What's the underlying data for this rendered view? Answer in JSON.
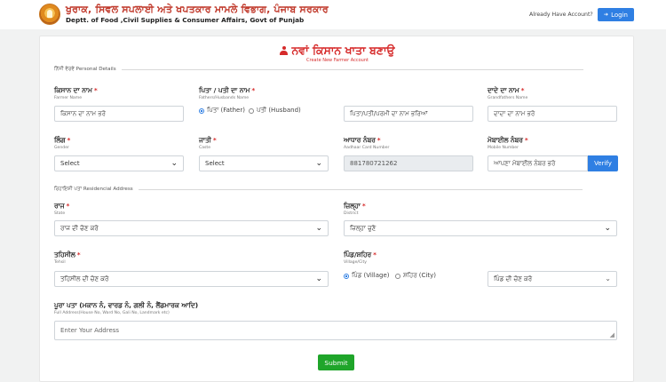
{
  "header": {
    "org_title": "ਖੁਰਾਕ, ਸਿਵਲ ਸਪਲਾਈ ਅਤੇ ਖਪਤਕਾਰ ਮਾਮਲੇ ਵਿਭਾਗ, ਪੰਜਾਬ ਸਰਕਾਰ",
    "org_subtitle": "Deptt. of Food ,Civil Supplies & Consumer Affairs, Govt of Punjab",
    "already_account": "Already Have Account?",
    "login_label": "Login",
    "logo_icon": "state-emblem-icon",
    "login_icon": "sign-in-icon"
  },
  "form": {
    "title": "ਨਵਾਂ ਕਿਸਾਨ ਖਾਤਾ ਬਣਾਉ",
    "subtitle": "Create New Farmer Account",
    "title_icon": "user-icon",
    "personal_section": "ਨਿੱਜੀ ਵੇਰਵੇ  Personal Details",
    "residential_section": "ਰਿਹਾਇਸ਼ੀ ਪਤਾ  Residencial Address",
    "farmer_name": {
      "label": "ਕਿਸਾਨ ਦਾ ਨਾਮ",
      "sublabel": "Farmer Name",
      "placeholder": "ਕਿਸਾਨ ਦਾ ਨਾਮ ਭਰੋ"
    },
    "father_husband": {
      "label": "ਪਿਤਾ / ਪਤੀ ਦਾ ਨਾਮ",
      "sublabel": "Fathers/Husbands Name",
      "option_father": "ਪਿਤਾ (Father)",
      "option_husband": "ਪਤੀ (Husband)",
      "placeholder": "ਪਿਤਾ/ਪਤੀ/ਪਰਮੀ ਦਾ ਨਾਮ ਭਰਿਆਂ"
    },
    "grandfather": {
      "label": "ਦਾਦੇ ਦਾ ਨਾਮ",
      "sublabel": "Grandfathers Name",
      "placeholder": "ਦਾਦਾ ਦਾ ਨਾਮ ਭਰੋ"
    },
    "gender": {
      "label": "ਲਿੰਗ",
      "sublabel": "Gender",
      "selected": "Select"
    },
    "caste": {
      "label": "ਜਾਤੀ",
      "sublabel": "Caste",
      "selected": "Select"
    },
    "aadhaar": {
      "label": "ਆਧਾਰ ਨੰਬਰ",
      "sublabel": "Aadhaar Card Number",
      "value": "881780721262"
    },
    "mobile": {
      "label": "ਮੋਬਾਈਲ ਨੰਬਰ",
      "sublabel": "Mobile Number",
      "placeholder": "ਆਪਣਾ ਮੋਬਾਈਲ ਨੰਬਰ ਭਰੋ",
      "verify_label": "Verify"
    },
    "state": {
      "label": "ਰਾਜ",
      "sublabel": "State",
      "selected": "ਰਾਜ ਦੀ ਚੋਣ ਕਰੋ"
    },
    "district": {
      "label": "ਜ਼ਿਲ੍ਹਾ",
      "sublabel": "District",
      "selected": "ਜ਼ਿਲ੍ਹਾ ਚੁਣੋ"
    },
    "tehsil": {
      "label": "ਤਹਿਸੀਲ",
      "sublabel": "Tehsil",
      "selected": "ਤਹਿਸੀਲ ਦੀ ਚੋਣ ਕਰੋ"
    },
    "village_city": {
      "label": "ਪਿੰਡ/ਸ਼ਹਿਰ",
      "sublabel": "Village/City",
      "option_village": "ਪਿੰਡ (Village)",
      "option_city": "ਸ਼ਹਿਰ (City)",
      "selected": "ਪਿੰਡ ਦੀ ਚੋਣ ਕਰੋ"
    },
    "address": {
      "label": "ਪੂਰਾ ਪਤਾ (ਮਕਾਨ ਨੰ, ਵਾਰਡ ਨੰ, ਗਲੀ ਨੰ, ਲੈਂਡਮਾਰਕ ਆਦਿ)",
      "sublabel": "Full Address(House No, Ward No, Gali No, Landmark etc)",
      "placeholder": "Enter Your Address"
    },
    "submit_label": "Submit",
    "required_mark": "*",
    "chevron_icon": "chevron-down-icon"
  },
  "colors": {
    "accent": "#2f7fe3",
    "title_red": "#d62b2b",
    "submit_green": "#1fa52a",
    "page_bg": "#f1f2f2"
  }
}
